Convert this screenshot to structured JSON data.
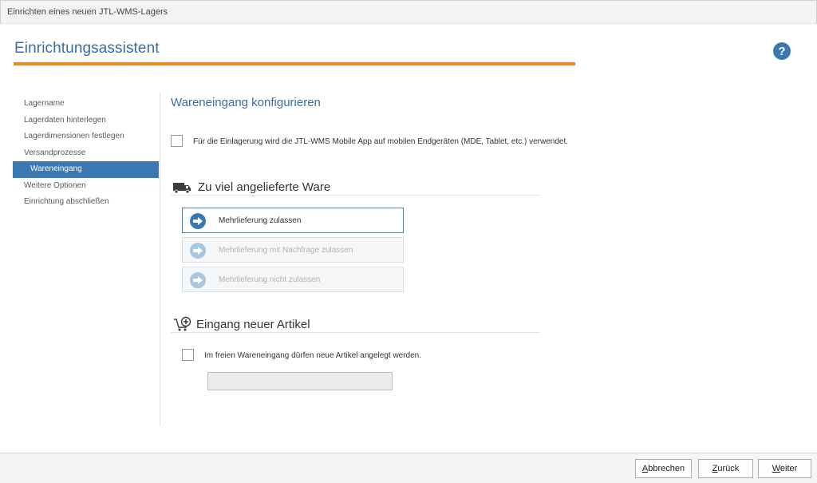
{
  "window": {
    "title": "Einrichten eines neuen JTL-WMS-Lagers"
  },
  "header": {
    "title": "Einrichtungsassistent",
    "accent_color": "#ef8a1e",
    "help_icon": "question-circle-icon"
  },
  "sidebar": {
    "items": [
      {
        "label": "Lagername",
        "active": false
      },
      {
        "label": "Lagerdaten hinterlegen",
        "active": false
      },
      {
        "label": "Lagerdimensionen festlegen",
        "active": false
      },
      {
        "label": "Versandprozesse",
        "active": false
      },
      {
        "label": "Wareneingang",
        "active": true
      },
      {
        "label": "Weitere Optionen",
        "active": false
      },
      {
        "label": "Einrichtung abschließen",
        "active": false
      }
    ]
  },
  "main": {
    "title": "Wareneingang konfigurieren",
    "mobile_app_checkbox": {
      "label": "Für die Einlagerung wird die JTL-WMS Mobile App auf mobilen Endgeräten (MDE, Tablet, etc.) verwendet.",
      "checked": false
    },
    "overdelivery": {
      "title": "Zu viel angelieferte Ware",
      "icon": "truck-icon",
      "options": [
        {
          "label": "Mehrlieferung zulassen",
          "selected": true
        },
        {
          "label": "Mehrlieferung mit Nachfrage zulassen",
          "selected": false
        },
        {
          "label": "Mehrlieferung nicht zulassen",
          "selected": false
        }
      ]
    },
    "new_articles": {
      "title": "Eingang neuer Artikel",
      "icon": "cart-add-icon",
      "checkbox": {
        "label": "Im freien Wareneingang dürfen neue Artikel angelegt werden.",
        "checked": false
      },
      "input_value": ""
    }
  },
  "footer": {
    "cancel": {
      "accel": "A",
      "rest": "bbrechen"
    },
    "back": {
      "accel": "Z",
      "rest": "urück"
    },
    "next": {
      "accel": "W",
      "rest": "eiter"
    }
  }
}
